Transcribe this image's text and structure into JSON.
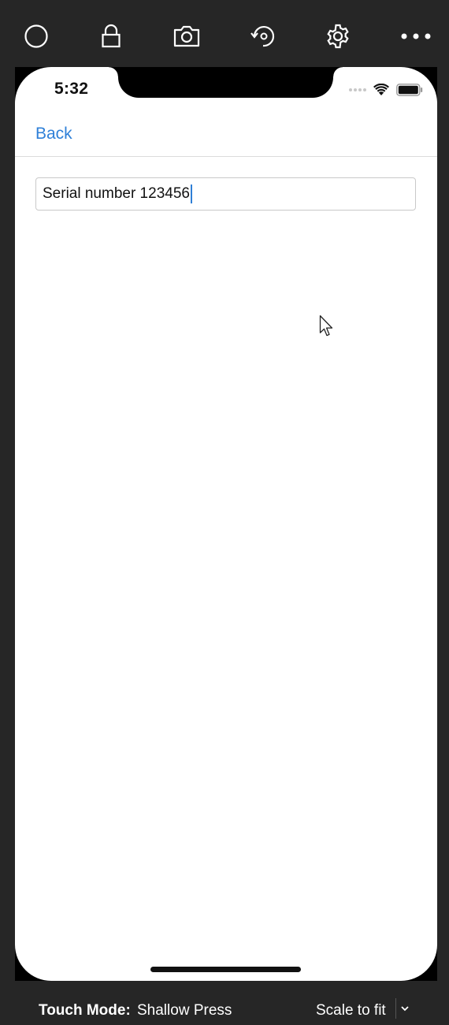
{
  "toolbar": {
    "icons": [
      "home-circle-icon",
      "lock-icon",
      "camera-icon",
      "rotate-icon",
      "gear-icon",
      "more-icon"
    ]
  },
  "status_bar": {
    "time": "5:32"
  },
  "nav": {
    "back_label": "Back"
  },
  "form": {
    "serial_value": "Serial number 123456"
  },
  "bottom_bar": {
    "touch_mode_label": "Touch Mode:",
    "touch_mode_value": "Shallow Press",
    "scale_value": "Scale to fit"
  },
  "colors": {
    "chrome": "#262626",
    "link": "#2f80d8",
    "caret": "#2f7fd6"
  }
}
